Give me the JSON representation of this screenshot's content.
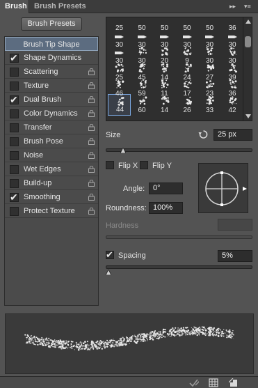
{
  "tabs": {
    "brush": "Brush",
    "brush_presets": "Brush Presets"
  },
  "header": {
    "expand_glyph": "▸▸",
    "menu_glyph": "▾≡"
  },
  "left_panel": {
    "presets_button": "Brush Presets",
    "items": [
      {
        "label": "Brush Tip Shape",
        "checked": false,
        "header": true
      },
      {
        "label": "Shape Dynamics",
        "checked": true
      },
      {
        "label": "Scattering",
        "checked": false
      },
      {
        "label": "Texture",
        "checked": false
      },
      {
        "label": "Dual Brush",
        "checked": true
      },
      {
        "label": "Color Dynamics",
        "checked": false
      },
      {
        "label": "Transfer",
        "checked": false
      },
      {
        "label": "Brush Pose",
        "checked": false
      },
      {
        "label": "Noise",
        "checked": false
      },
      {
        "label": "Wet Edges",
        "checked": false
      },
      {
        "label": "Build-up",
        "checked": false
      },
      {
        "label": "Smoothing",
        "checked": true
      },
      {
        "label": "Protect Texture",
        "checked": false
      }
    ]
  },
  "brush_grid": {
    "cells": [
      "25",
      "50",
      "50",
      "50",
      "50",
      "36",
      "30",
      "30",
      "30",
      "30",
      "30",
      "30",
      "30",
      "30",
      "20",
      "9",
      "30",
      "30",
      "25",
      "45",
      "14",
      "24",
      "27",
      "39",
      "46",
      "59",
      "11",
      "17",
      "23",
      "36",
      "44",
      "60",
      "14",
      "26",
      "33",
      "42"
    ],
    "selected_index": 30
  },
  "size": {
    "label": "Size",
    "value": "25 px",
    "slider_fraction": 0.12
  },
  "flip": {
    "flip_x": "Flip X",
    "flip_y": "Flip Y",
    "flip_x_checked": false,
    "flip_y_checked": false
  },
  "angle": {
    "label": "Angle:",
    "value": "0°"
  },
  "roundness": {
    "label": "Roundness:",
    "value": "100%"
  },
  "hardness": {
    "label": "Hardness",
    "value": "",
    "disabled": true
  },
  "spacing": {
    "label": "Spacing",
    "value": "5%",
    "checked": true,
    "slider_fraction": 0.02
  },
  "colors": {
    "accent": "#7aa7e0",
    "panel": "#535353",
    "field": "#2d2d2d"
  }
}
